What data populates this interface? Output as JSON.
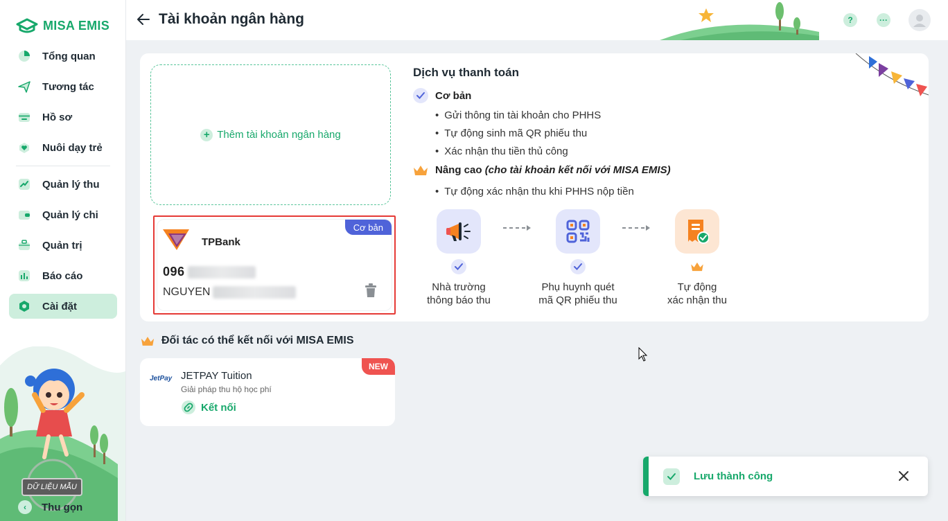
{
  "app": {
    "logo_text": "MISA EMIS"
  },
  "sidebar": {
    "items": [
      {
        "label": "Tổng quan",
        "icon": "pie-chart-icon"
      },
      {
        "label": "Tương tác",
        "icon": "send-icon"
      },
      {
        "label": "Hồ sơ",
        "icon": "folder-icon"
      },
      {
        "label": "Nuôi dạy trẻ",
        "icon": "heart-icon"
      },
      {
        "label": "Quản lý thu",
        "icon": "trend-up-icon"
      },
      {
        "label": "Quản lý chi",
        "icon": "wallet-icon"
      },
      {
        "label": "Quản trị",
        "icon": "briefcase-icon"
      },
      {
        "label": "Báo cáo",
        "icon": "bar-chart-icon"
      },
      {
        "label": "Cài đặt",
        "icon": "settings-icon",
        "active": true
      }
    ],
    "sample_badge": "DỮ LIỆU MẪU",
    "collapse_label": "Thu gọn"
  },
  "header": {
    "title": "Tài khoản ngân hàng",
    "help_icon": "?",
    "more_icon": "···"
  },
  "bank": {
    "add_label": "Thêm tài khoản ngân hàng",
    "tag": "Cơ bản",
    "name": "TPBank",
    "account_prefix": "096",
    "holder_prefix": "NGUYEN"
  },
  "services": {
    "title": "Dịch vụ thanh toán",
    "basic_label": "Cơ bản",
    "basic_items": [
      "Gửi thông tin tài khoản cho PHHS",
      "Tự động sinh mã QR phiếu thu",
      "Xác nhận thu tiền thủ công"
    ],
    "advanced_label": "Nâng cao",
    "advanced_note": "(cho tài khoản kết nối với MISA EMIS)",
    "advanced_items": [
      "Tự động xác nhận thu khi PHHS nộp tiền"
    ],
    "steps": [
      {
        "label_1": "Nhà trường",
        "label_2": "thông báo thu"
      },
      {
        "label_1": "Phụ huynh quét",
        "label_2": "mã QR phiếu thu"
      },
      {
        "label_1": "Tự động",
        "label_2": "xác nhận thu"
      }
    ]
  },
  "partners": {
    "title": "Đối tác có thể kết nối với MISA EMIS",
    "card": {
      "badge": "NEW",
      "logo_text": "JetPay",
      "name": "JETPAY Tuition",
      "description": "Giải pháp thu hộ học phí",
      "connect_label": "Kết nối"
    }
  },
  "toast": {
    "message": "Lưu thành công"
  },
  "colors": {
    "brand": "#17a86b",
    "basic_tag": "#4f63d9",
    "new_tag": "#ef5350",
    "highlight_border": "#e53935"
  }
}
